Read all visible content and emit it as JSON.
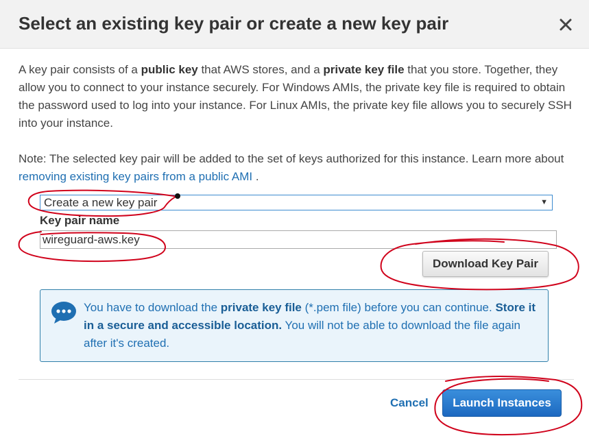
{
  "dialog": {
    "title": "Select an existing key pair or create a new key pair"
  },
  "intro": {
    "t1": "A key pair consists of a ",
    "b1": "public key",
    "t2": " that AWS stores, and a ",
    "b2": "private key file",
    "t3": " that you store. Together, they allow you to connect to your instance securely. For Windows AMIs, the private key file is required to obtain the password used to log into your instance. For Linux AMIs, the private key file allows you to securely SSH into your instance."
  },
  "note": {
    "text": "Note: The selected key pair will be added to the set of keys authorized for this instance. Learn more about ",
    "link": "removing existing key pairs from a public AMI",
    "after": " ."
  },
  "key_pair_select": {
    "selected": "Create a new key pair"
  },
  "key_pair_name": {
    "label": "Key pair name",
    "value": "wireguard-aws.key"
  },
  "download_button": "Download Key Pair",
  "info": {
    "t1": "You have to download the ",
    "b1": "private key file",
    "t2": " (*.pem file) before you can continue. ",
    "b2": "Store it in a secure and accessible location.",
    "t3": " You will not be able to download the file again after it's created."
  },
  "footer": {
    "cancel": "Cancel",
    "launch": "Launch Instances"
  },
  "colors": {
    "link": "#1f6fb2",
    "primary_button": "#1c68c0",
    "info_border": "#2f7fa9",
    "info_background": "#eaf4fb",
    "annotation": "#d0021b"
  },
  "icons": {
    "close": "close-icon",
    "info": "chat-bubble-icon",
    "select_caret": "caret-down-icon"
  }
}
